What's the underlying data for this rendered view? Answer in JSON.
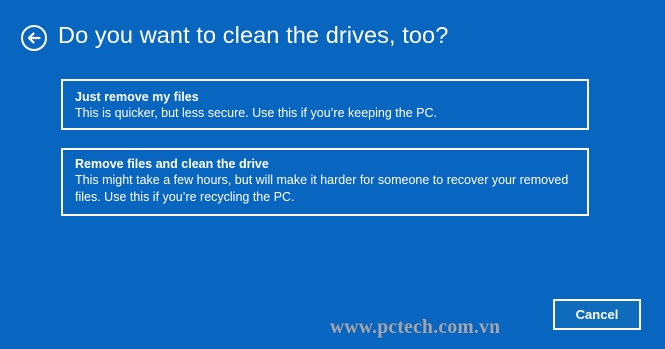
{
  "header": {
    "title": "Do you want to clean the drives, too?",
    "back_icon": "arrow-left-circle-icon"
  },
  "options": [
    {
      "title": "Just remove my files",
      "description": "This is quicker, but less secure. Use this if you’re keeping the PC."
    },
    {
      "title": "Remove files and clean the drive",
      "description": "This might take a few hours, but will make it harder for someone to recover your removed files. Use this if you’re recycling the PC."
    }
  ],
  "footer": {
    "cancel_label": "Cancel"
  },
  "watermark": "www.pctech.com.vn",
  "colors": {
    "background": "#0866c0",
    "foreground": "#ffffff",
    "watermark": "#a7a4a8"
  }
}
